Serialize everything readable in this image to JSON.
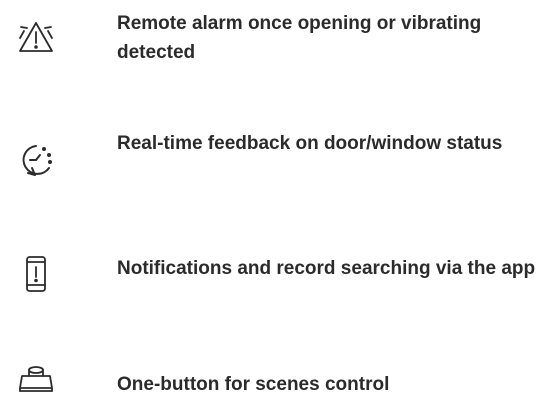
{
  "features": [
    {
      "icon": "warning-triangle-icon",
      "text": "Remote alarm once opening or vibrating detected"
    },
    {
      "icon": "refresh-clock-icon",
      "text": "Real-time feedback on door/window status"
    },
    {
      "icon": "smartphone-alert-icon",
      "text": "Notifications and record searching via the app"
    },
    {
      "icon": "push-button-icon",
      "text": "One-button for scenes control"
    }
  ],
  "colors": {
    "text": "#2b2b2b",
    "icon_stroke": "#2b2b2b",
    "background": "#ffffff"
  }
}
